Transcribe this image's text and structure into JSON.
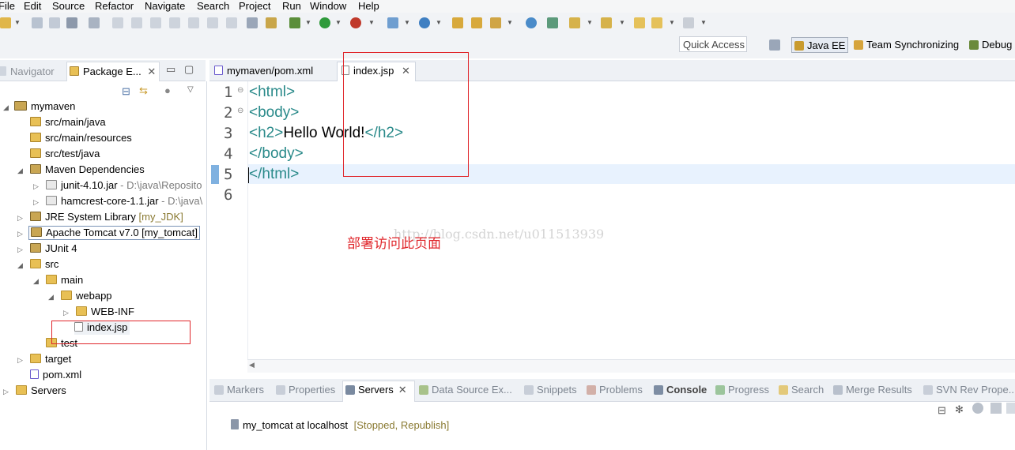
{
  "menu": [
    "File",
    "Edit",
    "Source",
    "Refactor",
    "Navigate",
    "Search",
    "Project",
    "Run",
    "Window",
    "Help"
  ],
  "quick_access": {
    "placeholder": "Quick Access"
  },
  "perspectives": [
    "Java EE",
    "Team Synchronizing",
    "Debug"
  ],
  "left_tabs": {
    "navigator": "Navigator",
    "package_explorer": "Package E..."
  },
  "tree": {
    "project": "mymaven",
    "src_main_java": "src/main/java",
    "src_main_resources": "src/main/resources",
    "src_test_java": "src/test/java",
    "maven_deps": "Maven Dependencies",
    "junit_jar": "junit-4.10.jar",
    "junit_path": "- D:\\java\\Reposito",
    "hamcrest_jar": "hamcrest-core-1.1.jar",
    "hamcrest_path": "- D:\\java\\",
    "jre": "JRE System Library",
    "jre_suffix": "[my_JDK]",
    "tomcat": "Apache Tomcat v7.0 [my_tomcat]",
    "junit4": "JUnit 4",
    "src": "src",
    "main": "main",
    "webapp": "webapp",
    "webinf": "WEB-INF",
    "indexjsp": "index.jsp",
    "test": "test",
    "target": "target",
    "pom": "pom.xml",
    "servers": "Servers"
  },
  "editor_tabs": {
    "pom": "mymaven/pom.xml",
    "index": "index.jsp"
  },
  "code": {
    "ln1": "1",
    "ln2": "2",
    "ln3": "3",
    "ln4": "4",
    "ln5": "5",
    "ln6": "6",
    "l1": "<html>",
    "l2": "<body>",
    "l3_open": "<h2>",
    "l3_text": "Hello World!",
    "l3_close": "</h2>",
    "l4": "</body>",
    "l5": "</html>"
  },
  "bottom_tabs": [
    "Markers",
    "Properties",
    "Servers",
    "Data Source Ex...",
    "Snippets",
    "Problems",
    "Console",
    "Progress",
    "Search",
    "Merge Results",
    "SVN Rev Prope..."
  ],
  "server": {
    "name": "my_tomcat at localhost",
    "status": "[Stopped, Republish]"
  },
  "annotation": {
    "text": "部署访问此页面"
  },
  "watermark": "http://blog.csdn.net/u011513939",
  "colors": {
    "tag": "#2a8a8a",
    "annotation": "#e0262b",
    "current_line": "#e8f2fe"
  }
}
